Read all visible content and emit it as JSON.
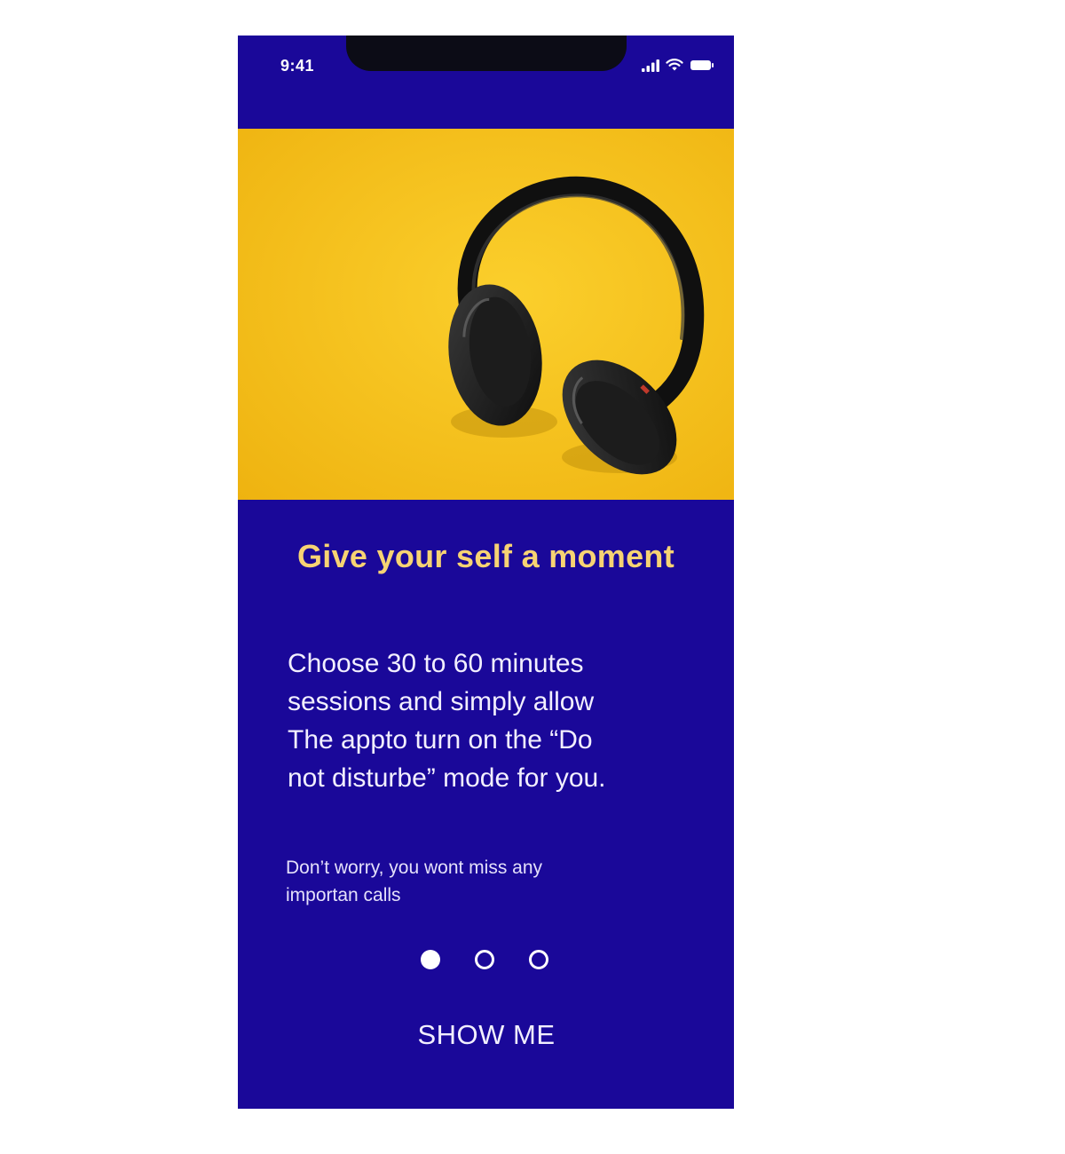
{
  "status_bar": {
    "time": "9:41",
    "icons": [
      "cellular-signal-icon",
      "wifi-icon",
      "battery-icon"
    ]
  },
  "hero": {
    "image": "headphones-photo",
    "background_color": "#f6bf19"
  },
  "onboarding": {
    "title": "Give your self a moment",
    "description": "Choose 30 to 60 minutes\nsessions and simply allow\nThe appto turn on the “Do\nnot disturbe” mode for you.",
    "note": "Don’t worry, you wont miss any\nimportan calls",
    "page_count": 3,
    "current_page": 1,
    "cta_label": "SHOW ME"
  },
  "colors": {
    "background": "#1a0899",
    "title": "#f7d373",
    "text": "#f2efff"
  }
}
